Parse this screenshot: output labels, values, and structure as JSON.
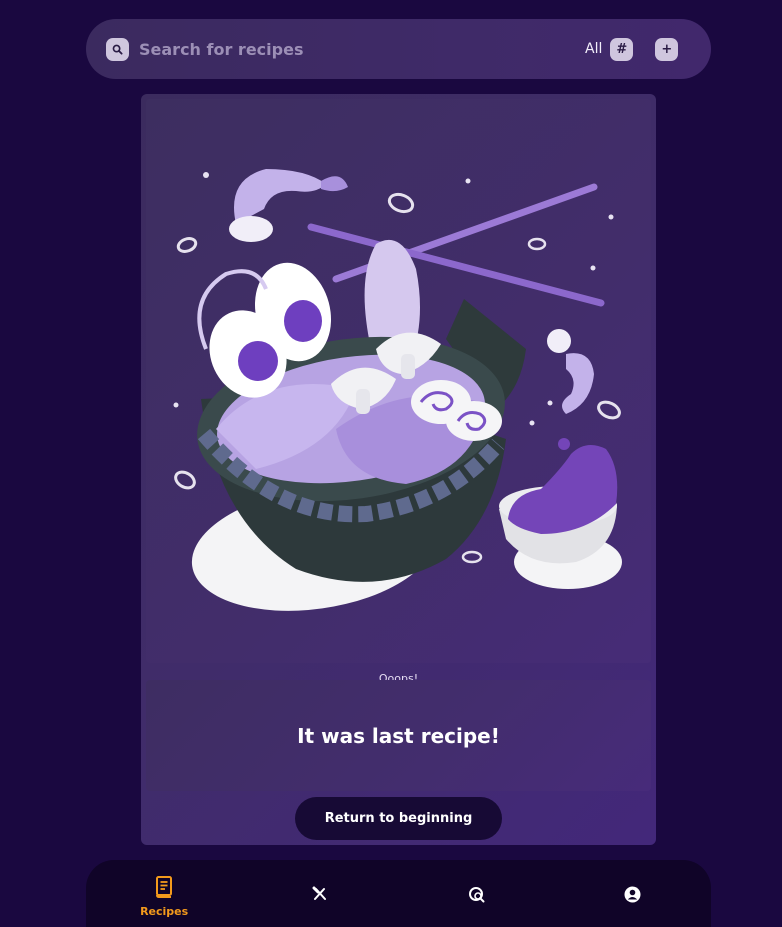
{
  "search": {
    "placeholder": "Search for recipes",
    "value": "",
    "filter_label": "All",
    "icons": {
      "search": "search-icon",
      "hash": "hash-icon",
      "add": "plus-icon"
    }
  },
  "card": {
    "caption": "Ooops!",
    "message": "It was last recipe!",
    "button_label": "Return to beginning",
    "illustration": "ramen-bowl-illustration"
  },
  "nav": {
    "items": [
      {
        "label": "Recipes",
        "icon": "recipe-book-icon",
        "active": true
      },
      {
        "label": "",
        "icon": "fork-knife-icon",
        "active": false
      },
      {
        "label": "",
        "icon": "search-dish-icon",
        "active": false
      },
      {
        "label": "",
        "icon": "user-icon",
        "active": false
      }
    ]
  },
  "colors": {
    "background": "#1a0840",
    "accent": "#f39a1c",
    "button_bg": "#170a35",
    "card": "#402c6a"
  }
}
